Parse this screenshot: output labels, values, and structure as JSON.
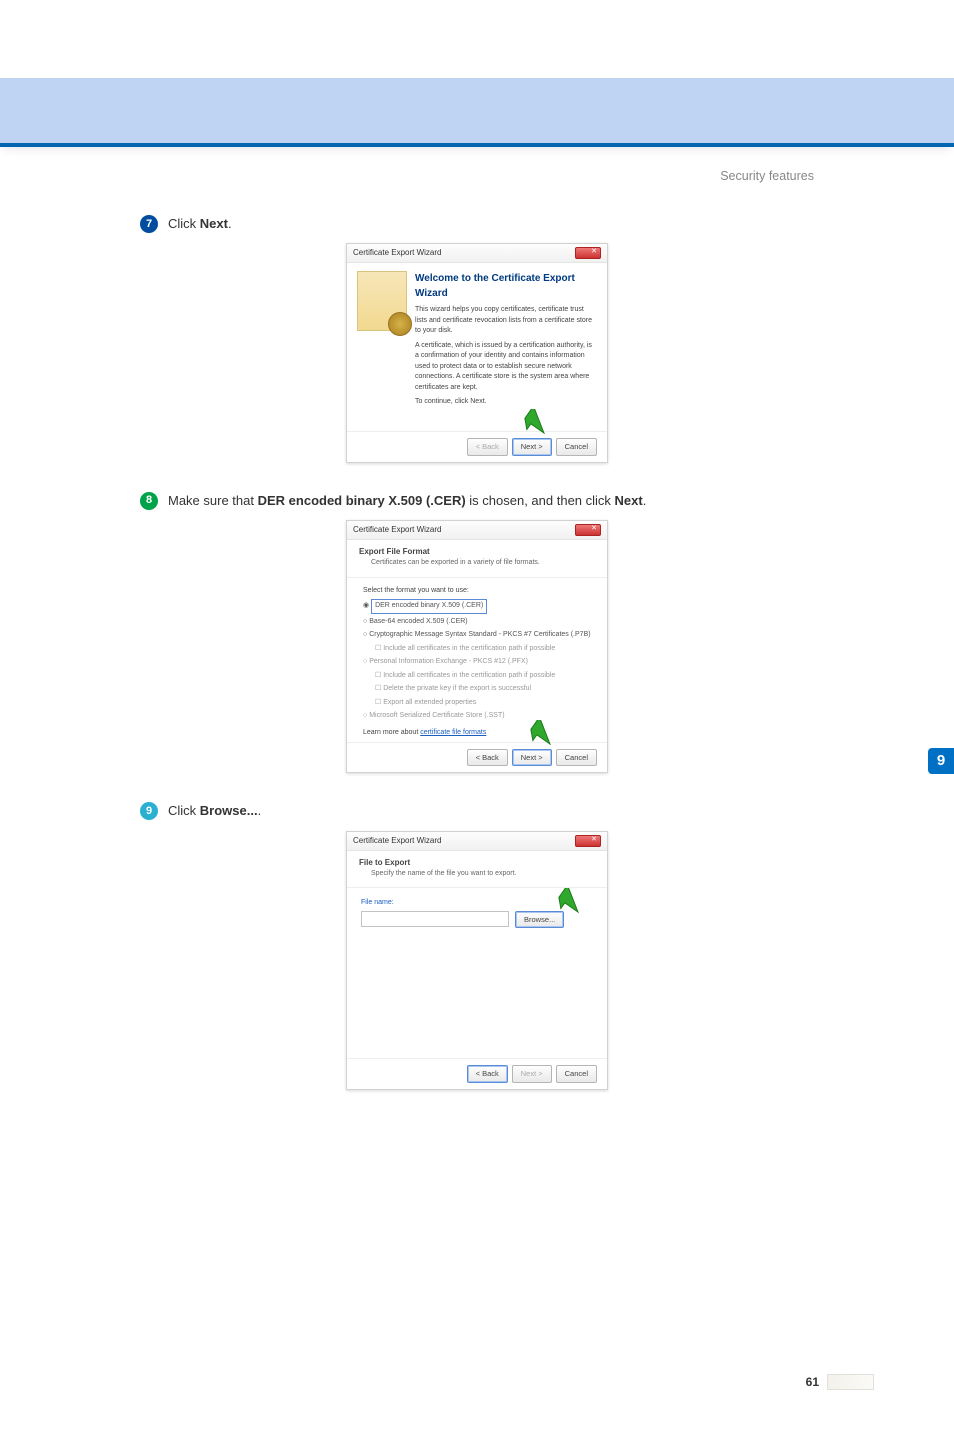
{
  "header": {
    "section_title": "Security features"
  },
  "sidebar_tab": {
    "label": "9"
  },
  "footer": {
    "page_number": "61"
  },
  "steps": {
    "s7": {
      "num": "7",
      "pre": "Click ",
      "bold": "Next",
      "post": "."
    },
    "s8": {
      "num": "8",
      "pre": "Make sure that ",
      "bold": "DER encoded binary X.509 (.CER)",
      "mid": " is chosen, and then click ",
      "bold2": "Next",
      "post": "."
    },
    "s9": {
      "num": "9",
      "pre": "Click ",
      "bold": "Browse...",
      "post": "."
    }
  },
  "wizard1": {
    "title": "Certificate Export Wizard",
    "h1": "Welcome to the Certificate Export Wizard",
    "p1": "This wizard helps you copy certificates, certificate trust lists and certificate revocation lists from a certificate store to your disk.",
    "p2": "A certificate, which is issued by a certification authority, is a confirmation of your identity and contains information used to protect data or to establish secure network connections. A certificate store is the system area where certificates are kept.",
    "p3": "To continue, click Next.",
    "btn_back": "< Back",
    "btn_next": "Next >",
    "btn_cancel": "Cancel"
  },
  "wizard2": {
    "title": "Certificate Export Wizard",
    "header": "Export File Format",
    "subheader": "Certificates can be exported in a variety of file formats.",
    "prompt": "Select the format you want to use:",
    "opt_der": "DER encoded binary X.509 (.CER)",
    "opt_b64": "Base-64 encoded X.509 (.CER)",
    "opt_p7b": "Cryptographic Message Syntax Standard - PKCS #7 Certificates (.P7B)",
    "opt_p7b_sub": "Include all certificates in the certification path if possible",
    "opt_pfx": "Personal Information Exchange - PKCS #12 (.PFX)",
    "opt_pfx_sub1": "Include all certificates in the certification path if possible",
    "opt_pfx_sub2": "Delete the private key if the export is successful",
    "opt_pfx_sub3": "Export all extended properties",
    "opt_sst": "Microsoft Serialized Certificate Store (.SST)",
    "learn_more_pre": "Learn more about ",
    "learn_more_link": "certificate file formats",
    "btn_back": "< Back",
    "btn_next": "Next >",
    "btn_cancel": "Cancel"
  },
  "wizard3": {
    "title": "Certificate Export Wizard",
    "header": "File to Export",
    "subheader": "Specify the name of the file you want to export.",
    "filename_label": "File name:",
    "browse": "Browse...",
    "btn_back": "< Back",
    "btn_next": "Next >",
    "btn_cancel": "Cancel"
  }
}
